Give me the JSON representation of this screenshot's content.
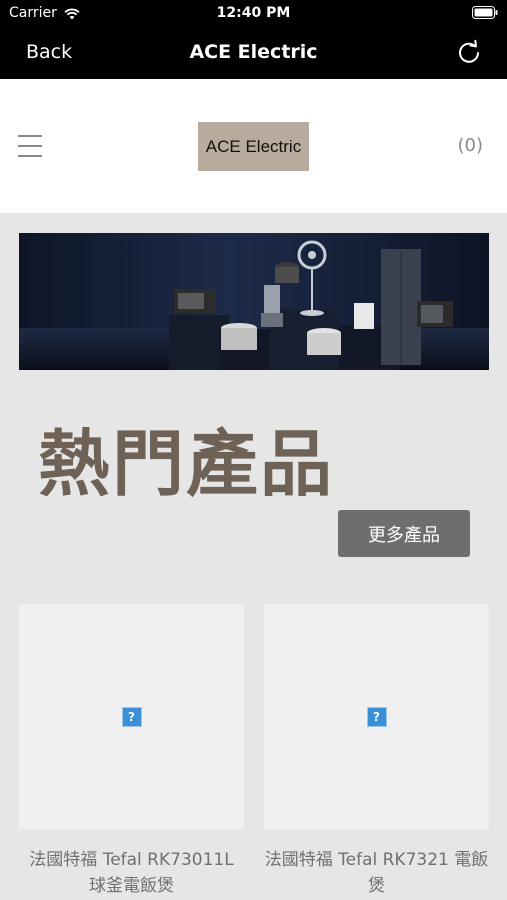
{
  "status_bar": {
    "carrier": "Carrier",
    "time": "12:40 PM"
  },
  "nav": {
    "back_label": "Back",
    "title": "ACE Electric"
  },
  "header": {
    "logo_text": "ACE Electric",
    "cart_count": "(0)"
  },
  "section": {
    "title": "熱門產品",
    "more_button": "更多產品"
  },
  "products": [
    {
      "name": "法國特福 Tefal RK73011L 球釜電飯煲"
    },
    {
      "name": "法國特福 Tefal RK7321 電飯煲"
    }
  ],
  "colors": {
    "nav_background": "#000000",
    "logo_background": "#b8ab9d",
    "title_color": "#6e6257",
    "button_background": "#6e6e6e",
    "page_background": "#e6e6e6"
  },
  "icons": {
    "wifi": "wifi-icon",
    "battery": "battery-icon",
    "refresh": "refresh-icon",
    "menu": "hamburger-menu-icon",
    "broken_image": "broken-image-icon"
  }
}
